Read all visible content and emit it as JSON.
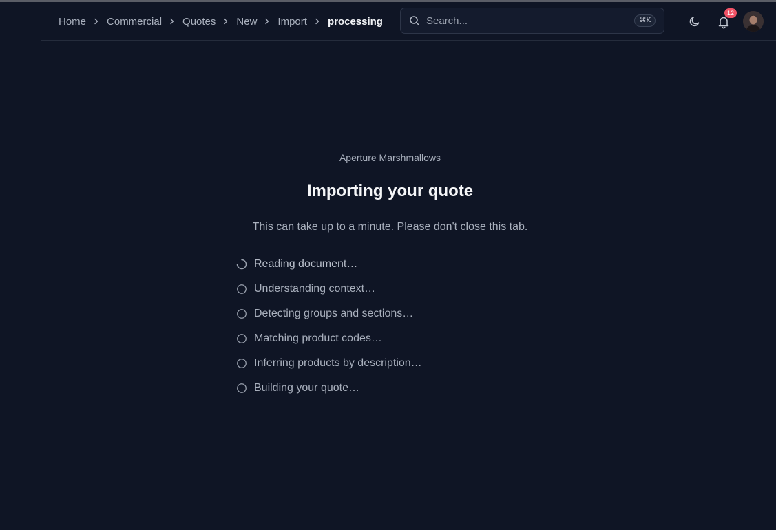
{
  "breadcrumb": {
    "items": [
      "Home",
      "Commercial",
      "Quotes",
      "New",
      "Import"
    ],
    "current": "processing"
  },
  "search": {
    "placeholder": "Search...",
    "shortcut": "⌘K"
  },
  "notifications": {
    "count": "12"
  },
  "icons": {
    "theme": "moon-icon",
    "notifications": "bell-icon",
    "search": "search-icon",
    "step_active": "spinner-icon",
    "step_pending": "circle-icon"
  },
  "import": {
    "company": "Aperture Marshmallows",
    "title": "Importing your quote",
    "subtitle": "This can take up to a minute. Please don't close this tab.",
    "steps": [
      {
        "label": "Reading document…",
        "status": "in-progress"
      },
      {
        "label": "Understanding context…",
        "status": "pending"
      },
      {
        "label": "Detecting groups and sections…",
        "status": "pending"
      },
      {
        "label": "Matching product codes…",
        "status": "pending"
      },
      {
        "label": "Inferring products by description…",
        "status": "pending"
      },
      {
        "label": "Building your quote…",
        "status": "pending"
      }
    ]
  },
  "colors": {
    "background": "#0f1525",
    "border": "#252c3c",
    "badge": "#f05266",
    "text_muted": "#a9b0bd",
    "text_strong": "#f5f6f8"
  }
}
